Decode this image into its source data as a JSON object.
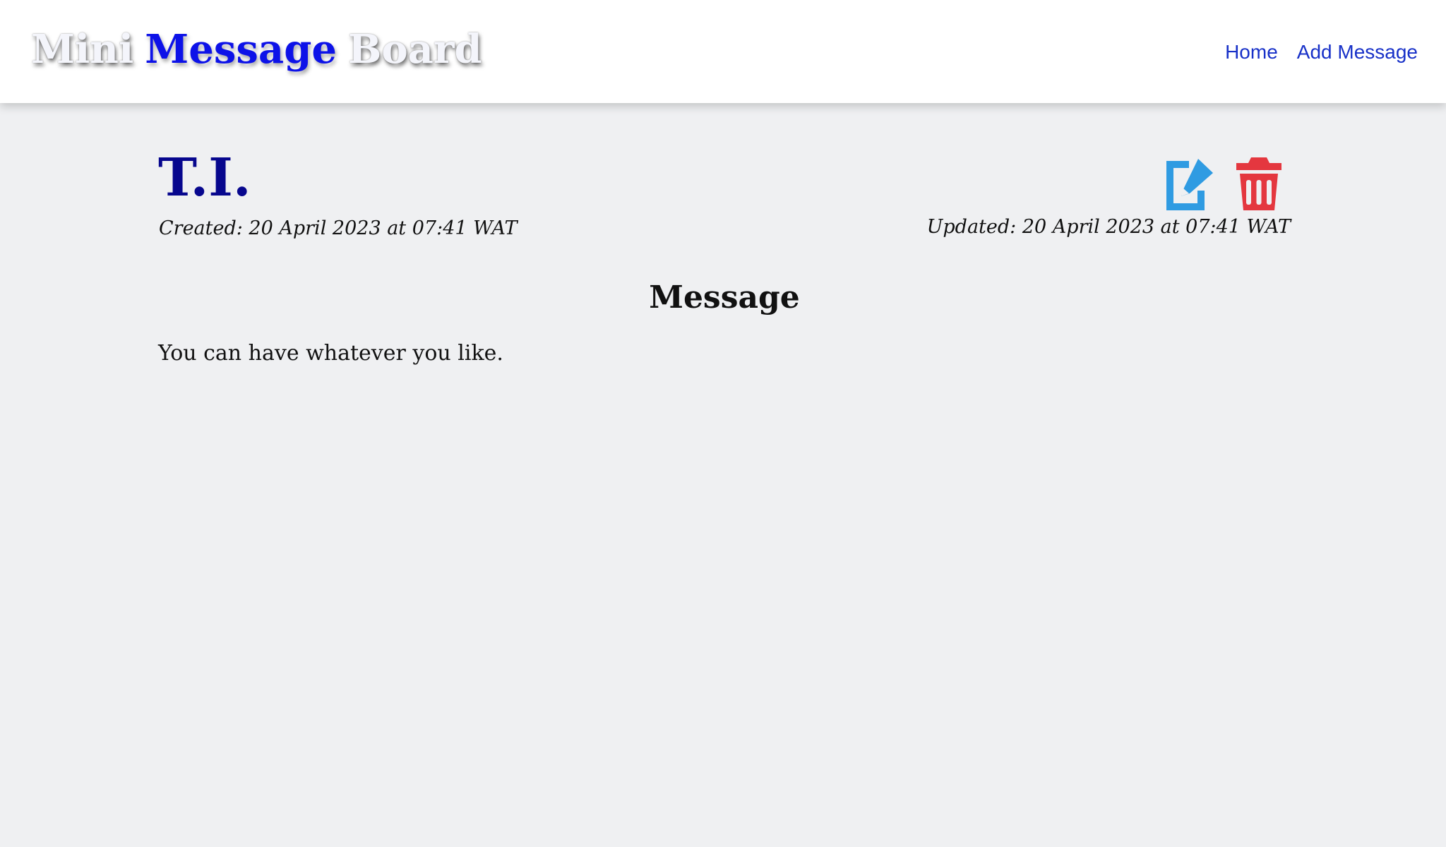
{
  "header": {
    "brand": {
      "first": "Mini",
      "accent": "Message",
      "last": "Board"
    },
    "nav": {
      "home": "Home",
      "add_message": "Add Message"
    }
  },
  "message": {
    "author": "T.I.",
    "created": "Created: 20 April 2023 at 07:41 WAT",
    "updated": "Updated: 20 April 2023 at 07:41 WAT",
    "section_title": "Message",
    "body": "You can have whatever you like."
  },
  "actions": {
    "edit_icon": "edit-icon",
    "delete_icon": "trash-icon"
  },
  "colors": {
    "background": "#eff0f2",
    "header_background": "#ffffff",
    "brand_accent": "#0d12e8",
    "nav_link": "#1831c8",
    "author": "#07078e",
    "edit": "#2f9be2",
    "delete": "#e4373f"
  }
}
